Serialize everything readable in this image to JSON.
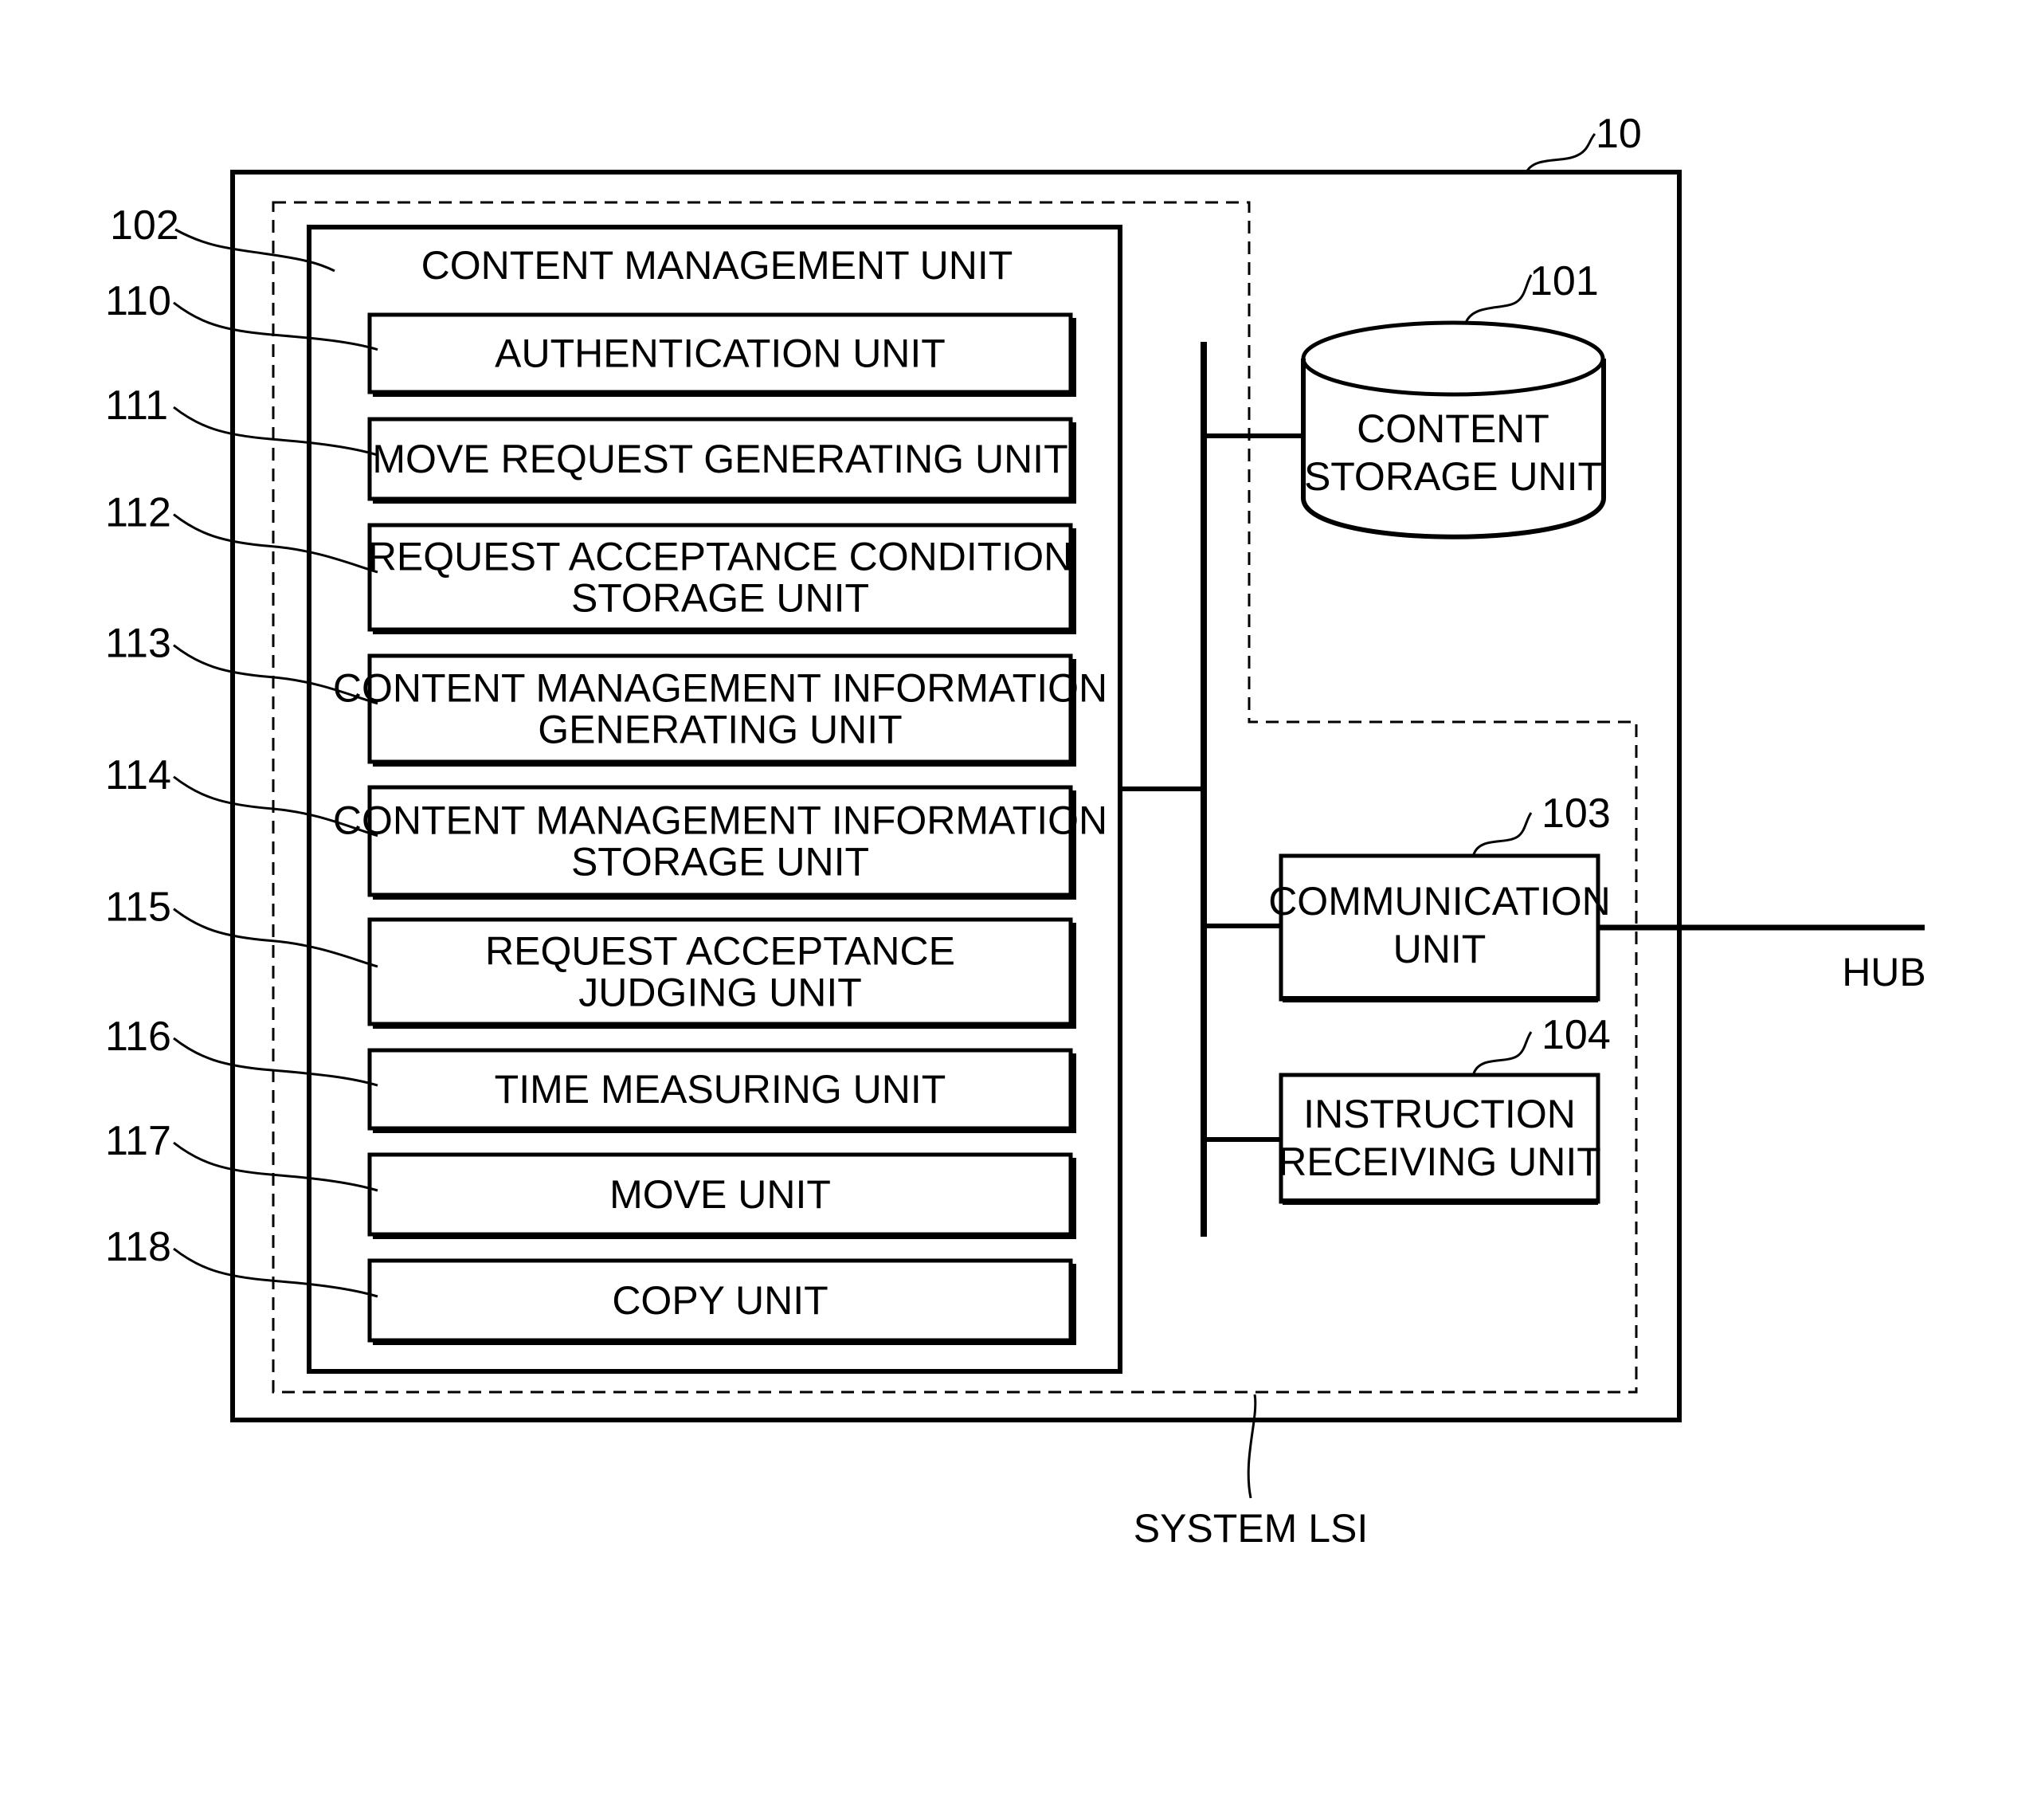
{
  "figure": {
    "device": {
      "ref": "10"
    },
    "system_lsi_label": "SYSTEM LSI",
    "content_management_unit": {
      "ref": "102",
      "title": "CONTENT MANAGEMENT UNIT",
      "sub_units": [
        {
          "ref": "110",
          "lines": [
            "AUTHENTICATION UNIT"
          ]
        },
        {
          "ref": "111",
          "lines": [
            "MOVE REQUEST GENERATING UNIT"
          ]
        },
        {
          "ref": "112",
          "lines": [
            "REQUEST ACCEPTANCE CONDITION",
            "STORAGE UNIT"
          ]
        },
        {
          "ref": "113",
          "lines": [
            "CONTENT MANAGEMENT INFORMATION",
            "GENERATING UNIT"
          ]
        },
        {
          "ref": "114",
          "lines": [
            "CONTENT MANAGEMENT INFORMATION",
            "STORAGE UNIT"
          ]
        },
        {
          "ref": "115",
          "lines": [
            "REQUEST ACCEPTANCE",
            "JUDGING UNIT"
          ]
        },
        {
          "ref": "116",
          "lines": [
            "TIME MEASURING UNIT"
          ]
        },
        {
          "ref": "117",
          "lines": [
            "MOVE UNIT"
          ]
        },
        {
          "ref": "118",
          "lines": [
            "COPY UNIT"
          ]
        }
      ]
    },
    "content_storage_unit": {
      "ref": "101",
      "lines": [
        "CONTENT",
        "STORAGE UNIT"
      ]
    },
    "communication_unit": {
      "ref": "103",
      "lines": [
        "COMMUNICATION",
        "UNIT"
      ]
    },
    "instruction_receiving_unit": {
      "ref": "104",
      "lines": [
        "INSTRUCTION",
        "RECEIVING UNIT"
      ]
    },
    "external": {
      "hub_label": "HUB"
    }
  }
}
